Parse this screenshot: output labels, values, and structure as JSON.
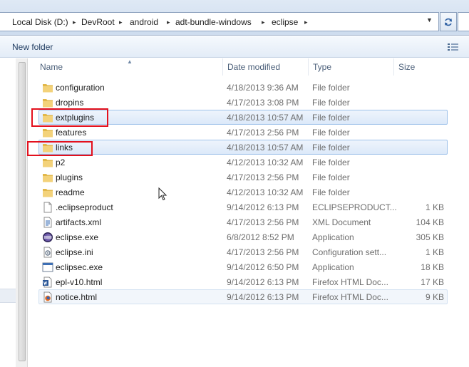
{
  "address": {
    "crumbs": [
      "Local Disk (D:)",
      "DevRoot",
      "android",
      "adt-bundle-windows",
      "eclipse"
    ]
  },
  "toolbar": {
    "new_folder_label": "New folder"
  },
  "columns": {
    "name": "Name",
    "date": "Date modified",
    "type": "Type",
    "size": "Size"
  },
  "files": [
    {
      "name": "configuration",
      "date": "4/18/2013 9:36 AM",
      "type": "File folder",
      "size": "",
      "icon": "folder-icon"
    },
    {
      "name": "dropins",
      "date": "4/17/2013 3:08 PM",
      "type": "File folder",
      "size": "",
      "icon": "folder-icon"
    },
    {
      "name": "extplugins",
      "date": "4/18/2013 10:57 AM",
      "type": "File folder",
      "size": "",
      "icon": "folder-icon"
    },
    {
      "name": "features",
      "date": "4/17/2013 2:56 PM",
      "type": "File folder",
      "size": "",
      "icon": "folder-icon"
    },
    {
      "name": "links",
      "date": "4/18/2013 10:57 AM",
      "type": "File folder",
      "size": "",
      "icon": "folder-icon"
    },
    {
      "name": "p2",
      "date": "4/12/2013 10:32 AM",
      "type": "File folder",
      "size": "",
      "icon": "folder-icon"
    },
    {
      "name": "plugins",
      "date": "4/17/2013 2:56 PM",
      "type": "File folder",
      "size": "",
      "icon": "folder-icon"
    },
    {
      "name": "readme",
      "date": "4/12/2013 10:32 AM",
      "type": "File folder",
      "size": "",
      "icon": "folder-icon"
    },
    {
      "name": ".eclipseproduct",
      "date": "9/14/2012 6:13 PM",
      "type": "ECLIPSEPRODUCT...",
      "size": "1 KB",
      "icon": "blank-file-icon"
    },
    {
      "name": "artifacts.xml",
      "date": "4/17/2013 2:56 PM",
      "type": "XML Document",
      "size": "104 KB",
      "icon": "xml-file-icon"
    },
    {
      "name": "eclipse.exe",
      "date": "6/8/2012 8:52 PM",
      "type": "Application",
      "size": "305 KB",
      "icon": "eclipse-icon"
    },
    {
      "name": "eclipse.ini",
      "date": "4/17/2013 2:56 PM",
      "type": "Configuration sett...",
      "size": "1 KB",
      "icon": "ini-file-icon"
    },
    {
      "name": "eclipsec.exe",
      "date": "9/14/2012 6:50 PM",
      "type": "Application",
      "size": "18 KB",
      "icon": "app-icon"
    },
    {
      "name": "epl-v10.html",
      "date": "9/14/2012 6:13 PM",
      "type": "Firefox HTML Doc...",
      "size": "17 KB",
      "icon": "html-doc-icon"
    },
    {
      "name": "notice.html",
      "date": "9/14/2012 6:13 PM",
      "type": "Firefox HTML Doc...",
      "size": "9 KB",
      "icon": "firefox-html-icon"
    }
  ],
  "colors": {
    "highlight_border": "#e3101d",
    "selection_border": "#9ec1ea",
    "folder": "#e8c25a"
  }
}
